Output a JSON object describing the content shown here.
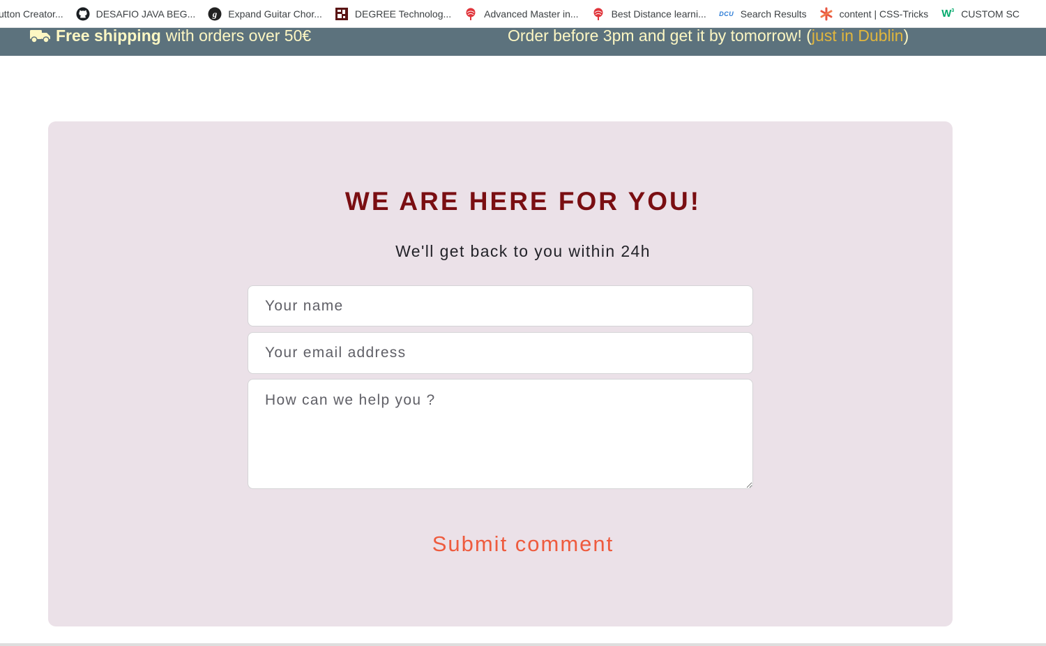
{
  "bookmarks": [
    {
      "label": "utton Creator...",
      "icon": "page-icon"
    },
    {
      "label": "DESAFIO JAVA BEG...",
      "icon": "github-icon"
    },
    {
      "label": "Expand Guitar Chor...",
      "icon": "guitar-g-icon"
    },
    {
      "label": "DEGREE Technolog...",
      "icon": "degree-icon"
    },
    {
      "label": "Advanced Master in...",
      "icon": "pin-globe-icon"
    },
    {
      "label": "Best Distance learni...",
      "icon": "pin-globe-icon"
    },
    {
      "label": "Search Results",
      "icon": "dcu-icon",
      "icon_text": "DCU"
    },
    {
      "label": "content | CSS-Tricks",
      "icon": "asterisk-icon"
    },
    {
      "label": "CUSTOM SC",
      "icon": "w3-icon",
      "icon_text": "W"
    }
  ],
  "promo": {
    "shipping_bold": "Free shipping",
    "shipping_rest": "with orders over 50€",
    "order_text": "Order before 3pm and get it by tomorrow! (",
    "order_highlight": "just in Dublin",
    "order_close": ")"
  },
  "contact": {
    "title": "WE ARE HERE FOR YOU!",
    "subtitle": "We'll get back to you within 24h",
    "name_placeholder": "Your name",
    "email_placeholder": "Your email address",
    "message_placeholder": "How can we help you ?",
    "submit_label": "Submit comment"
  },
  "colors": {
    "promo_bg": "#5c727d",
    "promo_text": "#fdf7c3",
    "promo_highlight": "#e1b63d",
    "card_bg": "#ebe1e8",
    "title": "#7a0e12",
    "submit": "#ee5b3e"
  }
}
